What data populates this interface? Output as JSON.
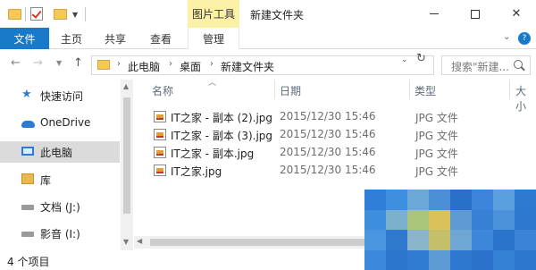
{
  "titlebar": {
    "context_tab": "图片工具",
    "window_title": "新建文件夹"
  },
  "ribbon": {
    "file": "文件",
    "home": "主页",
    "share": "共享",
    "view": "查看",
    "manage": "管理",
    "help": "?"
  },
  "address": {
    "crumbs": [
      "此电脑",
      "桌面",
      "新建文件夹"
    ],
    "separator": "›"
  },
  "search": {
    "placeholder": "搜索\"新建..."
  },
  "navpane": {
    "items": [
      {
        "label": "快速访问",
        "icon": "star-icon"
      },
      {
        "label": "OneDrive",
        "icon": "cloud-icon"
      },
      {
        "label": "此电脑",
        "icon": "computer-icon",
        "selected": true
      },
      {
        "label": "库",
        "icon": "library-icon"
      },
      {
        "label": "文档 (J:)",
        "icon": "drive-icon"
      },
      {
        "label": "影音 (I:)",
        "icon": "drive-icon"
      }
    ]
  },
  "columns": {
    "name": "名称",
    "date": "日期",
    "type": "类型",
    "size": "大小"
  },
  "files": [
    {
      "name": "IT之家 - 副本 (2).jpg",
      "date": "2015/12/30 15:46",
      "type": "JPG 文件"
    },
    {
      "name": "IT之家 - 副本 (3).jpg",
      "date": "2015/12/30 15:46",
      "type": "JPG 文件"
    },
    {
      "name": "IT之家 - 副本.jpg",
      "date": "2015/12/30 15:46",
      "type": "JPG 文件"
    },
    {
      "name": "IT之家.jpg",
      "date": "2015/12/30 15:46",
      "type": "JPG 文件"
    }
  ],
  "status": {
    "text": "4 个项目"
  },
  "colors": {
    "accent": "#1979ca",
    "context_tab": "#fbf1a6",
    "selection": "#dbdbdb"
  },
  "mosaic_colors": [
    "#2f7fd8",
    "#3f8fe0",
    "#6aa8d8",
    "#4b90d6",
    "#2a6fc9",
    "#3b84d9",
    "#5aa0df",
    "#2d7ad3",
    "#3d8edd",
    "#7cb0cf",
    "#a9c57a",
    "#d9c25a",
    "#5e9bd5",
    "#3780d6",
    "#4c92da",
    "#2f78cf",
    "#4a95e0",
    "#2f79cf",
    "#8ab4c9",
    "#c3bf6a",
    "#6fa6d3",
    "#3d86d9",
    "#2b74cc",
    "#3a83d7",
    "#3c88dc",
    "#2c76cf",
    "#2f7ad2",
    "#5c9bd4",
    "#2e78d0",
    "#2a72cb",
    "#3581d6",
    "#2d77d0"
  ]
}
